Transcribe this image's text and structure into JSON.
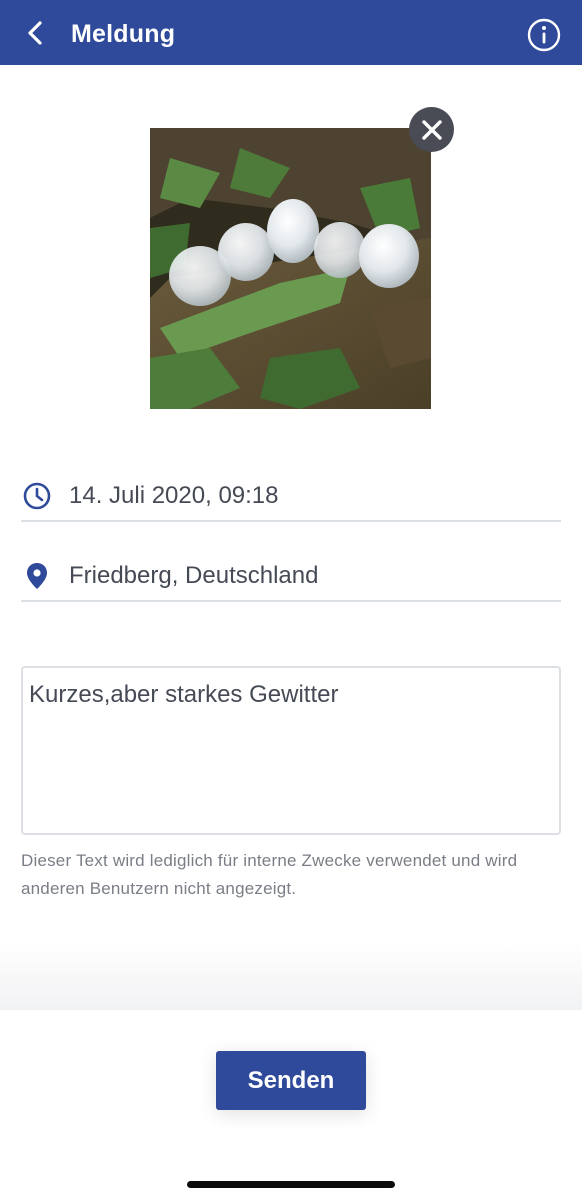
{
  "header": {
    "title": "Meldung",
    "back_icon": "chevron-left-icon",
    "info_icon": "info-circle-icon",
    "background_color": "#2f4a9a"
  },
  "photo": {
    "subject": "hailstones",
    "remove_icon": "close-icon"
  },
  "fields": {
    "date": {
      "icon": "clock-icon",
      "value": "14. Juli 2020, 09:18"
    },
    "location": {
      "icon": "location-pin-icon",
      "value": "Friedberg, Deutschland"
    }
  },
  "comment": {
    "value": "Kurzes,aber starkes Gewitter",
    "hint": "Dieser Text wird lediglich für interne Zwecke verwendet und wird anderen Benutzern nicht angezeigt."
  },
  "actions": {
    "send_label": "Senden",
    "accent_color": "#2f4a9a"
  }
}
